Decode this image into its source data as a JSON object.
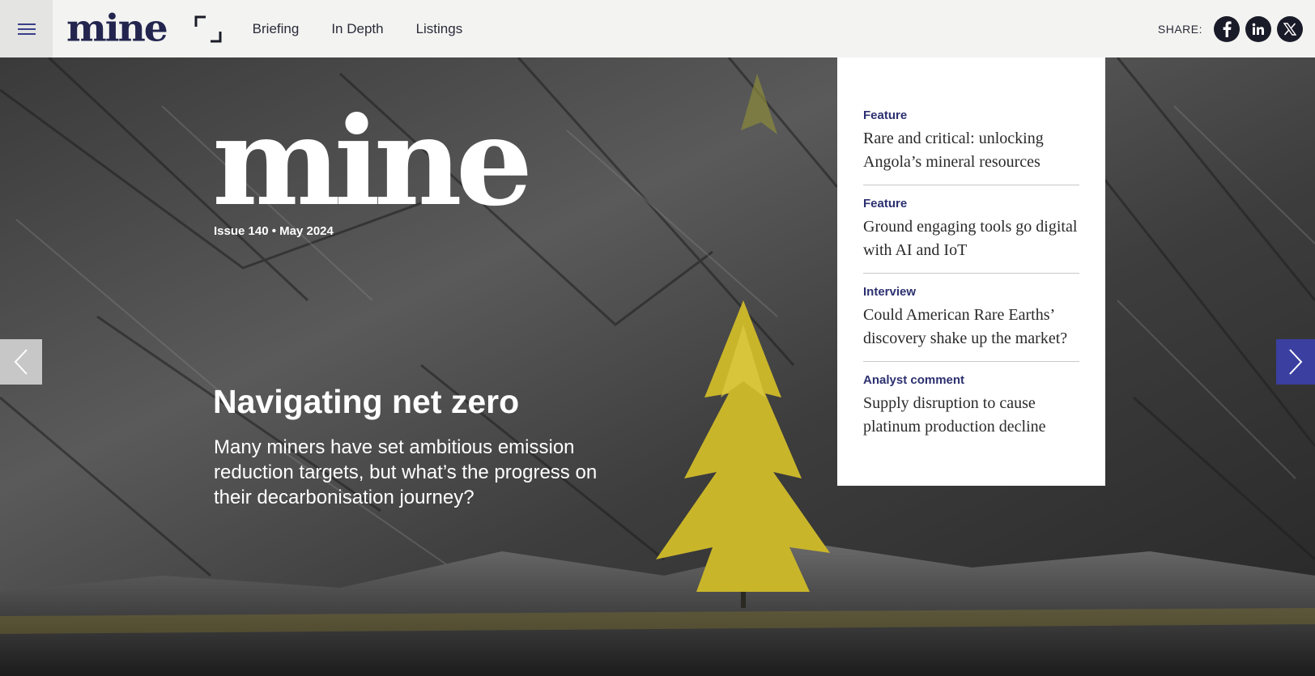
{
  "header": {
    "brand": "mine",
    "nav": [
      "Briefing",
      "In Depth",
      "Listings"
    ],
    "share_label": "SHARE:",
    "share_icons": [
      "facebook-icon",
      "linkedin-icon",
      "x-icon"
    ]
  },
  "hero": {
    "issue_logo": "mine",
    "issue_info": "Issue 140 • May 2024",
    "headline": "Navigating net zero",
    "standfirst": "Many miners have set ambitious emission reduction targets, but what’s the progress on their decarbonisation journey?"
  },
  "panel": {
    "articles": [
      {
        "category": "Feature",
        "title": "Rare and critical: unlocking Angola’s mineral resources"
      },
      {
        "category": "Feature",
        "title": "Ground engaging tools go digital with AI and IoT"
      },
      {
        "category": "Interview",
        "title": "Could American Rare Earths’ discovery shake up the market?"
      },
      {
        "category": "Analyst comment",
        "title": "Supply disruption to cause platinum production decline"
      }
    ]
  },
  "colors": {
    "brand_navy": "#23254f",
    "category_blue": "#2c3070",
    "arrow_blue": "#3a3fa0",
    "tree_yellow": "#c9b52a"
  }
}
